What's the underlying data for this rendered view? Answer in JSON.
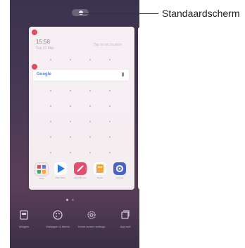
{
  "callout": {
    "label": "Standaardscherm"
  },
  "home_preview": {
    "clock": "15:58",
    "date": "Tue 21 Mar",
    "weather": "Tap to set location",
    "search_brand": "Google"
  },
  "apps": [
    {
      "name": "grid-app-icon",
      "label": "Tools",
      "color": "#f0e7ea"
    },
    {
      "name": "play-store-icon",
      "label": "Play Store",
      "color": "#2b7bd6"
    },
    {
      "name": "pen-app-icon",
      "label": "QuickMemo+",
      "color": "#e54d6f"
    },
    {
      "name": "notes-app-icon",
      "label": "Notes",
      "color": "#f2a63b"
    },
    {
      "name": "settings-app-icon",
      "label": "Settings",
      "color": "#4b63c9"
    }
  ],
  "bottom_bar": [
    {
      "name": "widgets-button",
      "icon": "widgets-icon",
      "label": "Widgets"
    },
    {
      "name": "wallpaper-theme-button",
      "icon": "palette-icon",
      "label": "Wallpaper & theme"
    },
    {
      "name": "home-screen-settings-button",
      "icon": "gear-icon",
      "label": "Home screen settings"
    },
    {
      "name": "app-sort-button",
      "icon": "app-sort-icon",
      "label": "App sort"
    }
  ],
  "colors": {
    "accent": "#e14a5f",
    "wallpaper_top": "#3a3350",
    "wallpaper_bottom": "#3b2f45"
  }
}
